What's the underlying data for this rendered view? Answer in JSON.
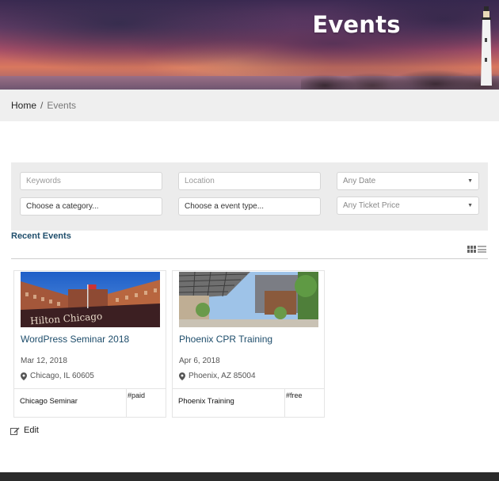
{
  "hero": {
    "title": "Events"
  },
  "breadcrumb": {
    "home": "Home",
    "separator": "/",
    "current": "Events"
  },
  "search": {
    "keywords_placeholder": "Keywords",
    "location_placeholder": "Location",
    "date_select": "Any Date",
    "category_select": "Choose a category...",
    "event_type_select": "Choose a event type...",
    "ticket_price_select": "Any Ticket Price"
  },
  "recent": {
    "title": "Recent Events"
  },
  "events": [
    {
      "title": "WordPress Seminar 2018",
      "date": "Mar 12, 2018",
      "location": "Chicago, IL 60605",
      "footer_name": "Chicago Seminar",
      "tag": "#paid"
    },
    {
      "title": "Phoenix CPR Training",
      "date": "Apr 6, 2018",
      "location": "Phoenix, AZ 85004",
      "footer_name": "Phoenix Training",
      "tag": "#free"
    }
  ],
  "edit": {
    "label": "Edit"
  },
  "colors": {
    "link": "#1e4d6b",
    "panel": "#ececec",
    "breadcrumb_bg": "#efefef",
    "footer_bar": "#2b2b2b"
  },
  "icons": {
    "location": "map-pin-icon",
    "edit": "pencil-square-icon",
    "grid_view": "grid-icon",
    "list_view": "list-icon",
    "select_caret": "caret-down-icon"
  }
}
